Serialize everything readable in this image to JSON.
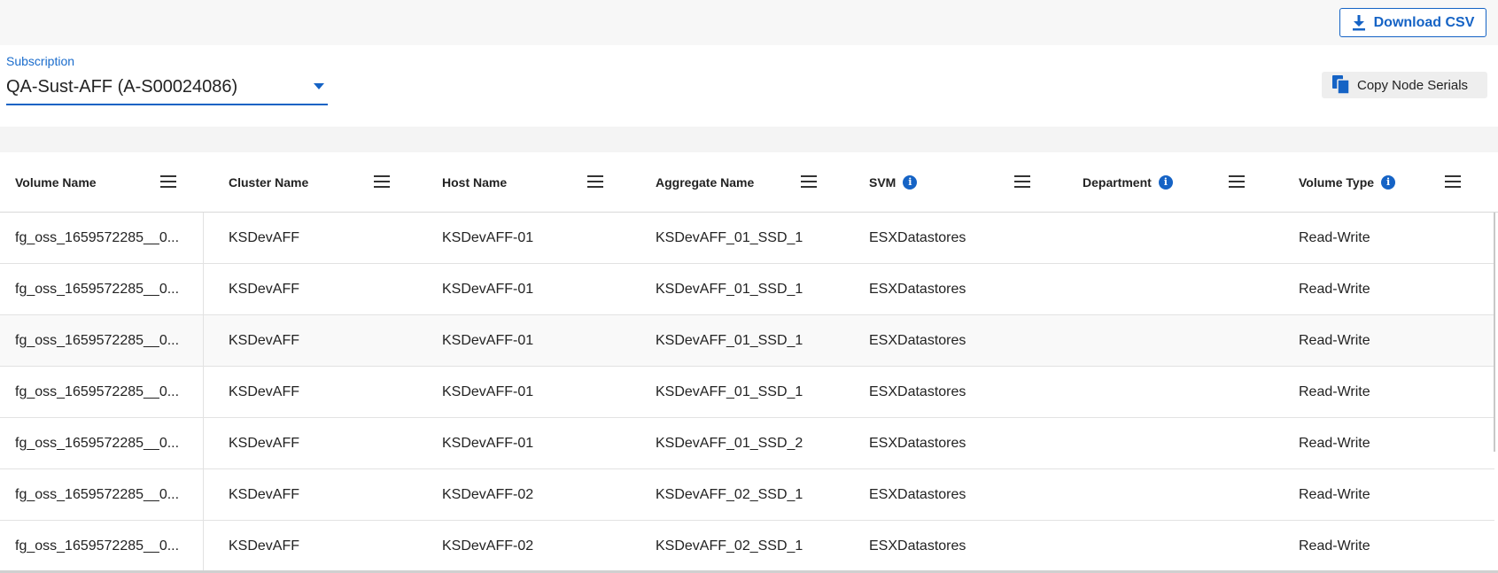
{
  "toolbar": {
    "download_label": "Download CSV",
    "copy_label": "Copy Node Serials"
  },
  "subscription": {
    "label": "Subscription",
    "value": "QA-Sust-AFF (A-S00024086)"
  },
  "table": {
    "columns": [
      {
        "label": "Volume Name",
        "info": false
      },
      {
        "label": "Cluster Name",
        "info": false
      },
      {
        "label": "Host Name",
        "info": false
      },
      {
        "label": "Aggregate Name",
        "info": false
      },
      {
        "label": "SVM",
        "info": true
      },
      {
        "label": "Department",
        "info": true
      },
      {
        "label": "Volume Type",
        "info": true
      }
    ],
    "rows": [
      [
        "fg_oss_1659572285__0...",
        "KSDevAFF",
        "KSDevAFF-01",
        "KSDevAFF_01_SSD_1",
        "ESXDatastores",
        "",
        "Read-Write"
      ],
      [
        "fg_oss_1659572285__0...",
        "KSDevAFF",
        "KSDevAFF-01",
        "KSDevAFF_01_SSD_1",
        "ESXDatastores",
        "",
        "Read-Write"
      ],
      [
        "fg_oss_1659572285__0...",
        "KSDevAFF",
        "KSDevAFF-01",
        "KSDevAFF_01_SSD_1",
        "ESXDatastores",
        "",
        "Read-Write"
      ],
      [
        "fg_oss_1659572285__0...",
        "KSDevAFF",
        "KSDevAFF-01",
        "KSDevAFF_01_SSD_1",
        "ESXDatastores",
        "",
        "Read-Write"
      ],
      [
        "fg_oss_1659572285__0...",
        "KSDevAFF",
        "KSDevAFF-01",
        "KSDevAFF_01_SSD_2",
        "ESXDatastores",
        "",
        "Read-Write"
      ],
      [
        "fg_oss_1659572285__0...",
        "KSDevAFF",
        "KSDevAFF-02",
        "KSDevAFF_02_SSD_1",
        "ESXDatastores",
        "",
        "Read-Write"
      ],
      [
        "fg_oss_1659572285__0...",
        "KSDevAFF",
        "KSDevAFF-02",
        "KSDevAFF_02_SSD_1",
        "ESXDatastores",
        "",
        "Read-Write"
      ]
    ]
  },
  "colors": {
    "accent": "#1563c5",
    "info_icon_glyph": "i"
  }
}
